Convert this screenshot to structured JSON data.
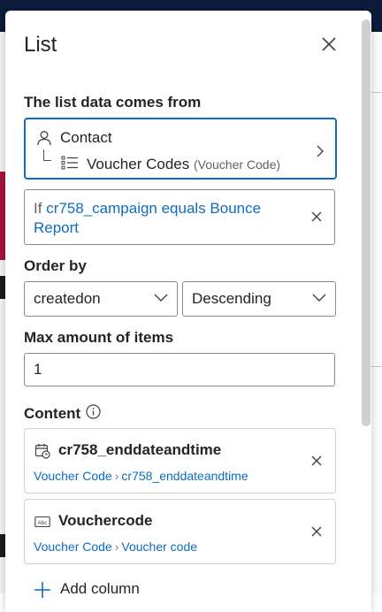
{
  "panel": {
    "title": "List"
  },
  "source": {
    "label": "The list data comes from",
    "primary_entity": "Contact",
    "related_entity": "Voucher Codes",
    "related_entity_note": "(Voucher Code)"
  },
  "filter": {
    "prefix": "If",
    "condition_line1": "cr758_campaign equals Bounce",
    "condition_line2": "Report"
  },
  "order_by": {
    "label": "Order by",
    "field": "createdon",
    "direction": "Descending"
  },
  "max_items": {
    "label": "Max amount of items",
    "value": "1"
  },
  "content": {
    "label": "Content",
    "items": [
      {
        "title": "cr758_enddateandtime",
        "path_root": "Voucher Code",
        "path_field": "cr758_enddateandtime",
        "icon": "calendar-clock-icon"
      },
      {
        "title": "Vouchercode",
        "path_root": "Voucher Code",
        "path_field": "Voucher code",
        "icon": "text-field-icon"
      }
    ],
    "add_label": "Add column"
  },
  "colors": {
    "accent": "#0f6cbd",
    "text": "#242424",
    "border": "#8a8a8a"
  }
}
